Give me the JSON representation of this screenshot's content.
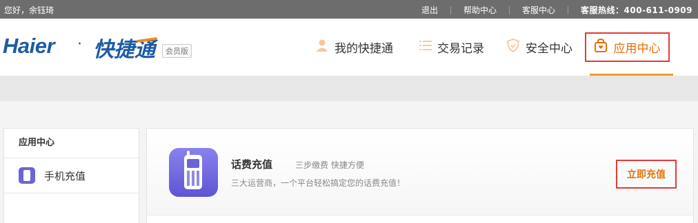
{
  "topbar": {
    "greeting": "您好，余钰琦",
    "links": [
      "退出",
      "帮助中心",
      "客服中心"
    ],
    "hotline": "客服热线：400-611-0909"
  },
  "logo": {
    "brand": "Haier",
    "dot": "·",
    "product": "快捷通",
    "badge": "会员版"
  },
  "nav": {
    "items": [
      {
        "label": "我的快捷通",
        "icon": "user-icon"
      },
      {
        "label": "交易记录",
        "icon": "list-icon"
      },
      {
        "label": "安全中心",
        "icon": "shield-icon"
      },
      {
        "label": "应用中心",
        "icon": "shopping-bag-icon",
        "active": true
      }
    ]
  },
  "sidebar": {
    "title": "应用中心",
    "items": [
      {
        "label": "手机充值",
        "icon": "mobile-phone-icon"
      }
    ]
  },
  "app": {
    "title": "话费充值",
    "subtitle": "三步缴费 快捷方便",
    "description": "三大运营商，一个平台轻松搞定您的话费充值！",
    "action": "立即充值"
  },
  "colors": {
    "accent": "#ef6c00",
    "brand": "#1d5aa5",
    "highlight_border": "#e53935",
    "app_purple": "#6c63d9"
  }
}
